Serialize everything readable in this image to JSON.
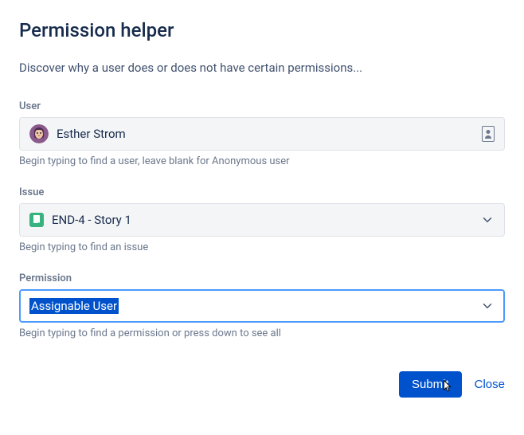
{
  "title": "Permission helper",
  "description": "Discover why a user does or does not have certain permissions...",
  "fields": {
    "user": {
      "label": "User",
      "value": "Esther Strom",
      "helper": "Begin typing to find a user, leave blank for Anonymous user"
    },
    "issue": {
      "label": "Issue",
      "value": "END-4 - Story 1",
      "helper": "Begin typing to find an issue"
    },
    "permission": {
      "label": "Permission",
      "value": "Assignable User",
      "helper": "Begin typing to find a permission or press down to see all"
    }
  },
  "actions": {
    "submit": "Submit",
    "close": "Close"
  }
}
